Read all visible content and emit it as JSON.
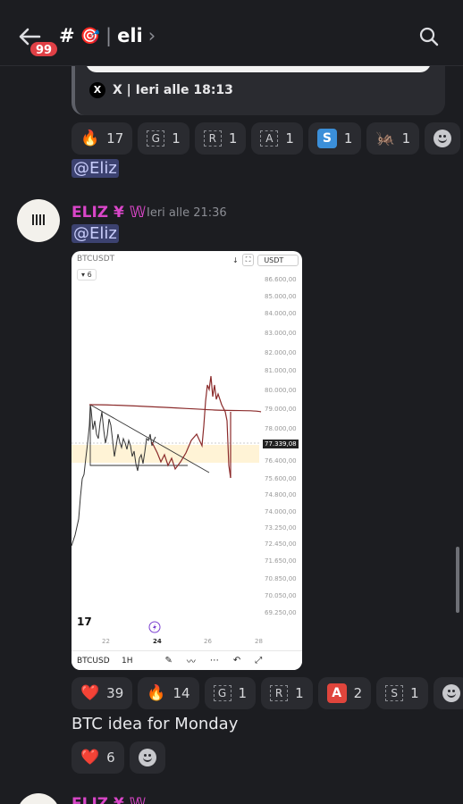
{
  "topbar": {
    "badge": "99",
    "channel_hash": "#",
    "channel_emoji": "🎯",
    "separator": "|",
    "channel_name": "eli",
    "chevron": "›"
  },
  "embed": {
    "source": "X | Ieri alle 18:13",
    "logo": "X"
  },
  "reactions_1": [
    {
      "emoji": "🔥",
      "count": "17"
    },
    {
      "glyph": "G",
      "count": "1"
    },
    {
      "glyph": "R",
      "count": "1"
    },
    {
      "glyph": "A",
      "count": "1"
    },
    {
      "glyph": "S",
      "count": "1"
    },
    {
      "emoji": "🦗",
      "count": "1"
    }
  ],
  "mention_1": "@Eliz",
  "message": {
    "author": "ELIZ ¥ 𝕎",
    "time": "Ieri alle 21:36",
    "mention": "@Eliz",
    "caption": "BTC idea for Monday"
  },
  "chart": {
    "symbol": "BTCUSDT",
    "interval_menu": "6",
    "currency": "USDT",
    "price_ticks": [
      "86.600,00",
      "85.000,00",
      "84.000,00",
      "83.000,00",
      "82.000,00",
      "81.000,00",
      "80.000,00",
      "79.000,00",
      "78.000,00",
      "76.400,00",
      "75.600,00",
      "74.800,00",
      "74.000,00",
      "73.250,00",
      "72.450,00",
      "71.650,00",
      "70.850,00",
      "70.050,00",
      "69.250,00"
    ],
    "current_price": "77.339,08",
    "x_ticks": [
      "22",
      "24",
      "26",
      "28"
    ],
    "toolbar_symbol": "BTCUSD",
    "toolbar_tf": "1H"
  },
  "chart_data": {
    "type": "line",
    "title": "BTCUSDT",
    "ylabel": "USDT",
    "ylim": [
      69250,
      86600
    ],
    "x": [
      "22",
      "24",
      "26",
      "28"
    ],
    "last_price": 77339.08,
    "series": [
      {
        "values": [
          72600,
          76500,
          79200,
          77800,
          77000,
          76100,
          77300
        ]
      }
    ]
  },
  "reactions_2": [
    {
      "emoji": "❤️",
      "count": "39"
    },
    {
      "emoji": "🔥",
      "count": "14"
    },
    {
      "glyph": "G",
      "count": "1"
    },
    {
      "glyph": "R",
      "count": "1"
    },
    {
      "glyph": "A",
      "count": "2"
    },
    {
      "glyph": "S",
      "count": "1"
    }
  ],
  "reactions_3": [
    {
      "emoji": "❤️",
      "count": "6"
    }
  ],
  "next_message": {
    "author": "ELIZ ¥ 𝕎"
  },
  "colors": {
    "background": "#1c1d21",
    "username": "#d946c8",
    "mention_bg": "#3c4270",
    "chip": "#2a2b30",
    "accent_blue": "#3b8fd9",
    "accent_red": "#e0453c"
  }
}
